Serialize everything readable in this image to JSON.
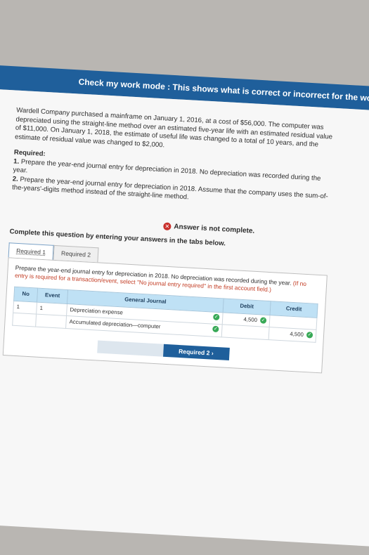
{
  "banner": {
    "text": "Check my work mode : This shows what is correct or incorrect for the work you have completed so far. It does not in"
  },
  "problem": {
    "paragraph": "Wardell Company purchased a mainframe on January 1, 2016, at a cost of $56,000. The computer was depreciated using the straight-line method over an estimated five-year life with an estimated residual value of $11,000. On January 1, 2018, the estimate of useful life was changed to a total of 10 years, and the estimate of residual value was changed to $2,000.",
    "required_title": "Required:",
    "req1_num": "1.",
    "req1_text": " Prepare the year-end journal entry for depreciation in 2018. No depreciation was recorded during the year.",
    "req2_num": "2.",
    "req2_text": " Prepare the year-end journal entry for depreciation in 2018. Assume that the company uses the sum-of-the-years'-digits method instead of the straight-line method."
  },
  "alert": {
    "text": "Answer is not complete."
  },
  "instruction": "Complete this question by entering your answers in the tabs below.",
  "tabs": [
    {
      "label": "Required 1"
    },
    {
      "label": "Required 2"
    }
  ],
  "panel": {
    "text": "Prepare the year-end journal entry for depreciation in 2018. No depreciation was recorded during the year. ",
    "hint": "(If no entry is required for a transaction/event, select \"No journal entry required\" in the first account field.)"
  },
  "journal": {
    "headers": [
      "No",
      "Event",
      "General Journal",
      "Debit",
      "Credit"
    ],
    "rows": [
      {
        "no": "1",
        "event": "1",
        "account": "Depreciation expense",
        "debit": "4,500",
        "credit": ""
      },
      {
        "no": "",
        "event": "",
        "account": "Accumulated depreciation—computer",
        "debit": "",
        "credit": "4,500"
      }
    ]
  },
  "nav": {
    "next_label": "Required 2  ›"
  }
}
